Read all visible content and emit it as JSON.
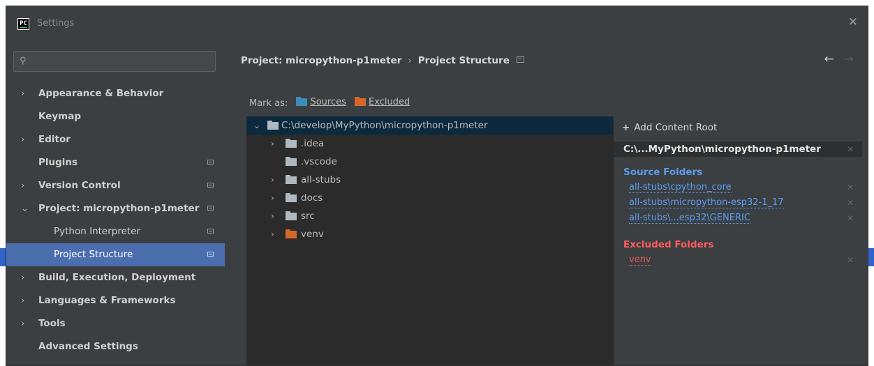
{
  "window": {
    "title": "Settings",
    "logo_text": "PC"
  },
  "search": {
    "placeholder": "",
    "value": ""
  },
  "sidebar": {
    "items": [
      {
        "label": "Appearance & Behavior",
        "chevron": "›",
        "pin": false
      },
      {
        "label": "Keymap",
        "chevron": "",
        "pin": false
      },
      {
        "label": "Editor",
        "chevron": "›",
        "pin": false
      },
      {
        "label": "Plugins",
        "chevron": "",
        "pin": true
      },
      {
        "label": "Version Control",
        "chevron": "›",
        "pin": true
      },
      {
        "label": "Project: micropython-p1meter",
        "chevron": "⌄",
        "pin": true
      },
      {
        "label": "Python Interpreter",
        "sub": true,
        "pin": true
      },
      {
        "label": "Project Structure",
        "sub": true,
        "pin": true,
        "selected": true
      },
      {
        "label": "Build, Execution, Deployment",
        "chevron": "›",
        "pin": false
      },
      {
        "label": "Languages & Frameworks",
        "chevron": "›",
        "pin": false
      },
      {
        "label": "Tools",
        "chevron": "›",
        "pin": false
      },
      {
        "label": "Advanced Settings",
        "chevron": "",
        "pin": false
      }
    ]
  },
  "breadcrumb": {
    "project": "Project: micropython-p1meter",
    "sep": "›",
    "page": "Project Structure"
  },
  "nav_arrows": {
    "back": "←",
    "forward": "→"
  },
  "mark_as": {
    "label": "Mark as:",
    "sources": "Sources",
    "excluded": "Excluded"
  },
  "tree": {
    "root": "C:\\develop\\MyPython\\micropython-p1meter",
    "children": [
      {
        "name": ".idea",
        "expandable": true,
        "color": "gray"
      },
      {
        "name": ".vscode",
        "expandable": false,
        "color": "gray"
      },
      {
        "name": "all-stubs",
        "expandable": true,
        "color": "gray"
      },
      {
        "name": "docs",
        "expandable": true,
        "color": "gray"
      },
      {
        "name": "src",
        "expandable": true,
        "color": "gray"
      },
      {
        "name": "venv",
        "expandable": true,
        "color": "orange"
      }
    ]
  },
  "content_root": {
    "add_label": "Add Content Root",
    "path": "C:\\...MyPython\\micropython-p1meter",
    "source_header": "Source Folders",
    "sources": [
      "all-stubs\\cpython_core",
      "all-stubs\\micropython-esp32-1_17",
      "all-stubs\\...esp32\\GENERIC"
    ],
    "excluded_header": "Excluded Folders",
    "excluded": [
      "venv"
    ]
  },
  "colors": {
    "accent": "#4b6eaf",
    "source": "#589df6",
    "excluded": "#e05a5a",
    "sources_folder": "#3c8dbc",
    "excluded_folder": "#d5672d"
  }
}
